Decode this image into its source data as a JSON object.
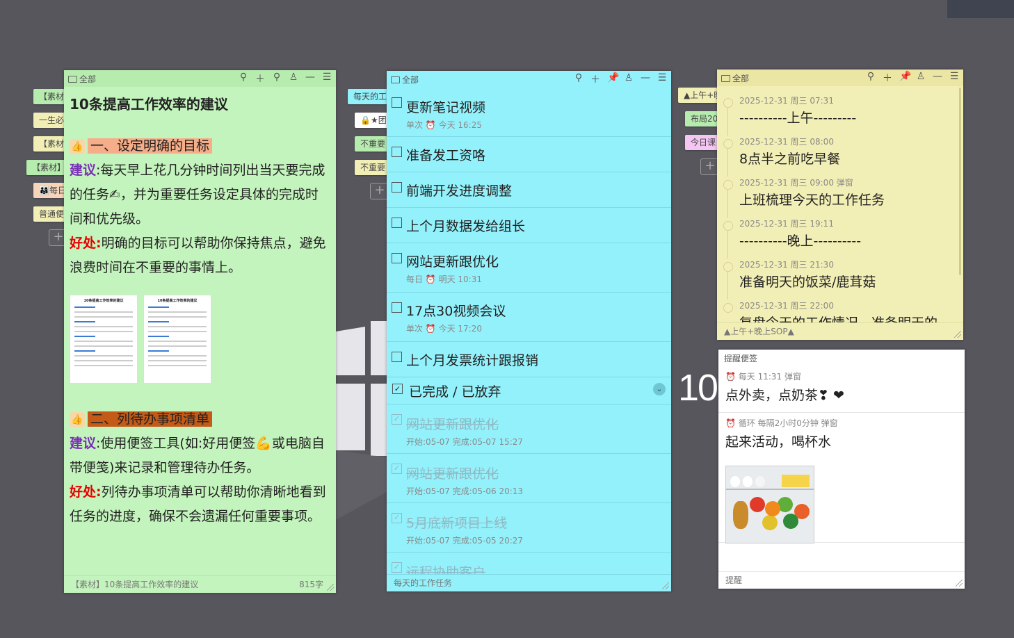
{
  "left_tabs": [
    "【素材",
    "一生必",
    "【素材",
    "【素材】",
    "👨‍👩‍👧每日",
    "普通便"
  ],
  "mid_tabs": [
    "每天的工",
    "🔒★团",
    "不重要",
    "不重要"
  ],
  "right_tabs": [
    "▲上午+晚",
    "布局20",
    "今日课"
  ],
  "clock": "10",
  "note_green": {
    "folder_label": "全部",
    "title": "10条提高工作效率的建议",
    "h1": "一、设定明确的目标",
    "p1_kw": "建议",
    "p1_text": ":每天早上花几分钟时间列出当天要完成的任务✍，并为重要任务设定具体的完成时间和优先级。",
    "p2_kw": "好处:",
    "p2_text": "明确的目标可以帮助你保持焦点，避免浪费时间在不重要的事情上。",
    "doc_title": "10条提高工作效率的建议",
    "h2": "二、列待办事项清单",
    "p3_kw": "建议",
    "p3_text": ":使用便签工具(如:好用便签💪或电脑自带便笺)来记录和管理待办任务。",
    "p4_kw": "好处:",
    "p4_text": "列待办事项清单可以帮助你清晰地看到任务的进度，确保不会遗漏任何重要事项。",
    "footer_title": "【素材】10条提高工作效率的建议",
    "footer_count": "815字"
  },
  "note_cyan": {
    "folder_label": "全部",
    "todos": [
      {
        "title": "更新笔记视频",
        "meta": "单次  ⏰  今天 16:25"
      },
      {
        "title": "准备发工资咯",
        "meta": ""
      },
      {
        "title": "前端开发进度调整",
        "meta": ""
      },
      {
        "title": "上个月数据发给组长",
        "meta": ""
      },
      {
        "title": "网站更新跟优化",
        "meta": "每日  ⏰  明天 10:31"
      },
      {
        "title": "17点30视频会议",
        "meta": "单次  ⏰  今天 17:20"
      },
      {
        "title": "上个月发票统计跟报销",
        "meta": ""
      }
    ],
    "done_header": "已完成 / 已放弃",
    "done": [
      {
        "title": "网站更新跟优化",
        "meta": "开始:05-07  完成:05-07 15:27"
      },
      {
        "title": "网站更新跟优化",
        "meta": "开始:05-07  完成:05-06 20:13"
      },
      {
        "title": "5月底新项目上线",
        "meta": "开始:05-07  完成:05-05 20:27"
      },
      {
        "title": "远程协助客户",
        "meta": ""
      }
    ],
    "footer_title": "每天的工作任务"
  },
  "note_yellow": {
    "folder_label": "全部",
    "items": [
      {
        "ts": "2025-12-31 周三 07:31",
        "text": "----------上午---------"
      },
      {
        "ts": "2025-12-31 周三 08:00",
        "text": "8点半之前吃早餐"
      },
      {
        "ts": "2025-12-31 周三 09:00  弹窗",
        "text": "上班梳理今天的工作任务"
      },
      {
        "ts": "2025-12-31 周三 19:11",
        "text": "----------晚上----------"
      },
      {
        "ts": "2025-12-31 周三 21:30",
        "text": "准备明天的饭菜/鹿茸菇"
      },
      {
        "ts": "2025-12-31 周三 22:00",
        "text": "复盘今天的工作情况，准备明天的"
      }
    ],
    "footer_title": "▲上午+晚上SOP▲"
  },
  "note_white": {
    "header": "提醒便签",
    "items": [
      {
        "meta": "⏰ 每天   11:31   弹窗",
        "text": "点外卖，点奶茶❣ ❤"
      },
      {
        "meta": "⏰ 循环   每隔2小时0分钟   弹窗",
        "text": "起来活动，喝杯水"
      }
    ],
    "footer_title": "提醒"
  },
  "colors": {
    "green": "#c4f4bd",
    "green_hdr": "#b7ecaf",
    "cyan": "#93f1fb",
    "yellow": "#f2efb6",
    "yellow_hdr": "#ebe6a3",
    "white": "#ffffff"
  }
}
